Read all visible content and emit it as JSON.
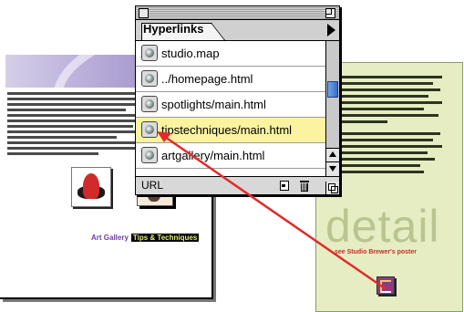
{
  "palette": {
    "tab_label": "Hyperlinks",
    "items": [
      {
        "label": "studio.map",
        "selected": false
      },
      {
        "label": "../homepage.html",
        "selected": false
      },
      {
        "label": "spotlights/main.html",
        "selected": false
      },
      {
        "label": "tipstechniques/main.html",
        "selected": true
      },
      {
        "label": "artgallery/main.html",
        "selected": false
      }
    ],
    "status_label": "URL"
  },
  "left_page": {
    "link_art_gallery": "Art Gallery",
    "link_tips": "Tips & Techniques"
  },
  "right_page": {
    "big_word": "detail",
    "caption": "see Studio Brewer's poster"
  },
  "colors": {
    "selection_highlight": "#fbf3a0",
    "drag_arrow": "#e02b2b",
    "scroll_thumb": "#3a6cc8"
  }
}
